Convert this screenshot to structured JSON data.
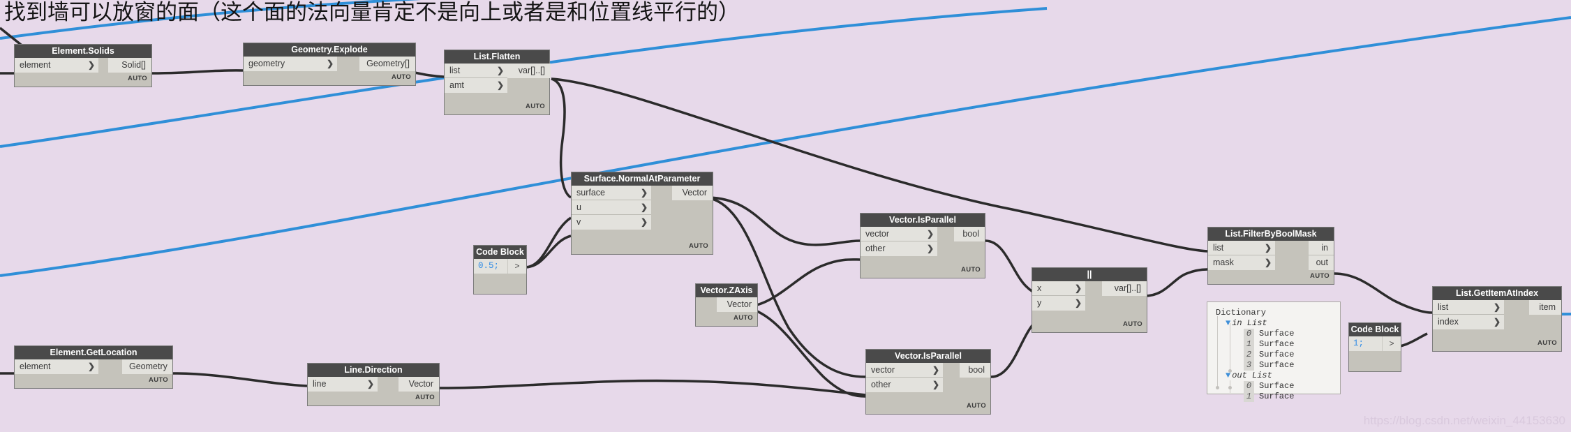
{
  "annotation": {
    "title": "找到墙可以放窗的面（这个面的法向量肯定不是向上或者是和位置线平行的）"
  },
  "watermark": "https://blog.csdn.net/weixin_44153630",
  "canvas": {
    "background_color": "#e7d9ea",
    "wire_color": "#2b2b2b",
    "highlight_wire_color": "#2f8fd8",
    "node_header_color": "#4a4a4a",
    "node_body_color": "#c5c3bb",
    "port_color": "#e3e2dd"
  },
  "nodes": [
    {
      "id": "element-solids",
      "title": "Element.Solids",
      "inputs": [
        "element"
      ],
      "outputs": [
        "Solid[]"
      ],
      "status": "AUTO"
    },
    {
      "id": "geometry-explode",
      "title": "Geometry.Explode",
      "inputs": [
        "geometry"
      ],
      "outputs": [
        "Geometry[]"
      ],
      "status": "AUTO"
    },
    {
      "id": "list-flatten",
      "title": "List.Flatten",
      "inputs": [
        "list",
        "amt"
      ],
      "outputs": [
        "var[]..[]"
      ],
      "status": "AUTO"
    },
    {
      "id": "surface-normalatparameter",
      "title": "Surface.NormalAtParameter",
      "inputs": [
        "surface",
        "u",
        "v"
      ],
      "outputs": [
        "Vector"
      ],
      "status": "AUTO"
    },
    {
      "id": "code-block-half",
      "title": "Code Block",
      "code": "0.5;",
      "port_symbol": ">"
    },
    {
      "id": "vector-zaxis",
      "title": "Vector.ZAxis",
      "inputs": [],
      "outputs": [
        "Vector"
      ],
      "status": "AUTO"
    },
    {
      "id": "vector-isparallel-top",
      "title": "Vector.IsParallel",
      "inputs": [
        "vector",
        "other"
      ],
      "outputs": [
        "bool"
      ],
      "status": "AUTO"
    },
    {
      "id": "vector-isparallel-bottom",
      "title": "Vector.IsParallel",
      "inputs": [
        "vector",
        "other"
      ],
      "outputs": [
        "bool"
      ],
      "status": "AUTO"
    },
    {
      "id": "or-operator",
      "title": "||",
      "inputs": [
        "x",
        "y"
      ],
      "outputs": [
        "var[]..[]"
      ],
      "status": "AUTO"
    },
    {
      "id": "list-filterbyboolmask",
      "title": "List.FilterByBoolMask",
      "inputs": [
        "list",
        "mask"
      ],
      "outputs": [
        "in",
        "out"
      ],
      "status": "AUTO"
    },
    {
      "id": "code-block-one",
      "title": "Code Block",
      "code": "1;",
      "port_symbol": ">"
    },
    {
      "id": "list-getitematindex",
      "title": "List.GetItemAtIndex",
      "inputs": [
        "list",
        "index"
      ],
      "outputs": [
        "item"
      ],
      "status": "AUTO"
    },
    {
      "id": "element-getlocation",
      "title": "Element.GetLocation",
      "inputs": [
        "element"
      ],
      "outputs": [
        "Geometry"
      ],
      "status": "AUTO"
    },
    {
      "id": "line-direction",
      "title": "Line.Direction",
      "inputs": [
        "line"
      ],
      "outputs": [
        "Vector"
      ],
      "status": "AUTO"
    }
  ],
  "dictionary_preview": {
    "title": "Dictionary",
    "groups": [
      {
        "label": "in List",
        "items": [
          {
            "index": "0",
            "value": "Surface"
          },
          {
            "index": "1",
            "value": "Surface"
          },
          {
            "index": "2",
            "value": "Surface"
          },
          {
            "index": "3",
            "value": "Surface"
          }
        ]
      },
      {
        "label": "out List",
        "items": [
          {
            "index": "0",
            "value": "Surface"
          },
          {
            "index": "1",
            "value": "Surface"
          }
        ]
      }
    ]
  }
}
